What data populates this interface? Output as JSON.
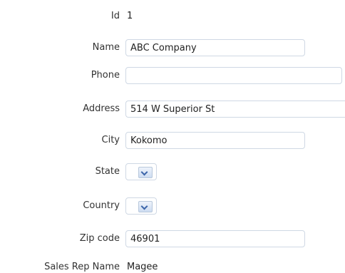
{
  "form": {
    "id": {
      "label": "Id",
      "value": "1"
    },
    "name": {
      "label": "Name",
      "value": "ABC Company",
      "placeholder": ""
    },
    "phone": {
      "label": "Phone",
      "value": "",
      "placeholder": ""
    },
    "address": {
      "label": "Address",
      "value": "514 W Superior St",
      "placeholder": ""
    },
    "city": {
      "label": "City",
      "value": "Kokomo",
      "placeholder": ""
    },
    "state": {
      "label": "State",
      "selected": "",
      "icon": "chevron-down-icon"
    },
    "country": {
      "label": "Country",
      "selected": "",
      "icon": "chevron-down-icon"
    },
    "zip": {
      "label": "Zip code",
      "value": "46901",
      "placeholder": ""
    },
    "sales_rep": {
      "label": "Sales Rep Name",
      "value": "Magee"
    }
  },
  "colors": {
    "border": "#cfd8e4",
    "dropdown_arrow": "#3c65a9"
  }
}
